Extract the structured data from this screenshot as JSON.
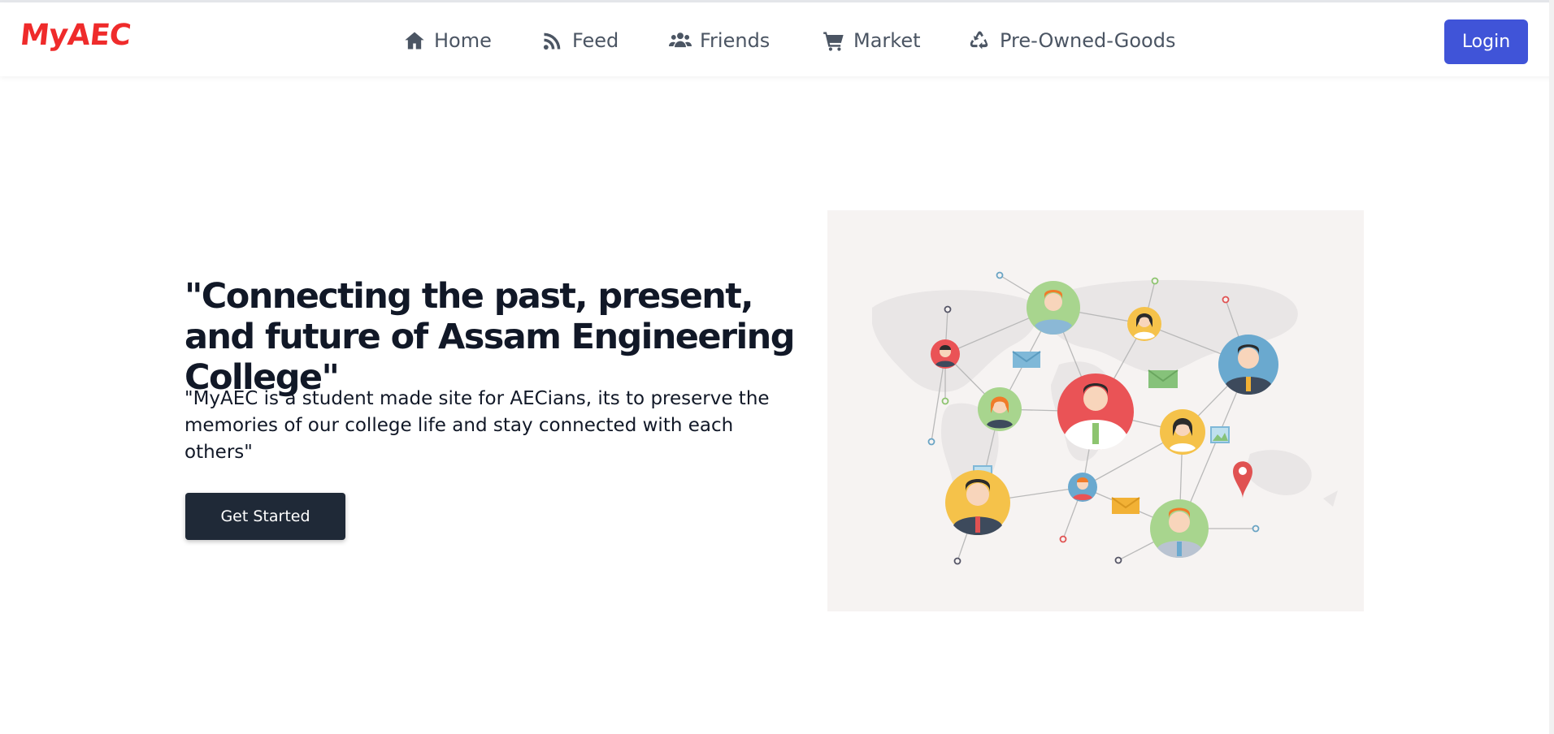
{
  "brand": {
    "logo": "MyAEC",
    "logo_color": "#ef2b2b"
  },
  "nav": {
    "items": [
      {
        "label": "Home",
        "icon": "home-icon"
      },
      {
        "label": "Feed",
        "icon": "rss-feed-icon"
      },
      {
        "label": "Friends",
        "icon": "users-icon"
      },
      {
        "label": "Market",
        "icon": "shopping-cart-icon"
      },
      {
        "label": "Pre-Owned-Goods",
        "icon": "recycle-icon"
      }
    ],
    "login_label": "Login",
    "login_color": "#4054d8"
  },
  "hero": {
    "title": "\"Connecting the past, present, and future of Assam Engineering College\"",
    "description": "\"MyAEC is a student made site for AECians, its to preserve the memories of our college life and stay connected with each others\"",
    "cta_label": "Get Started",
    "cta_color": "#1f2937",
    "illustration": "social-network-world-map-illustration"
  }
}
